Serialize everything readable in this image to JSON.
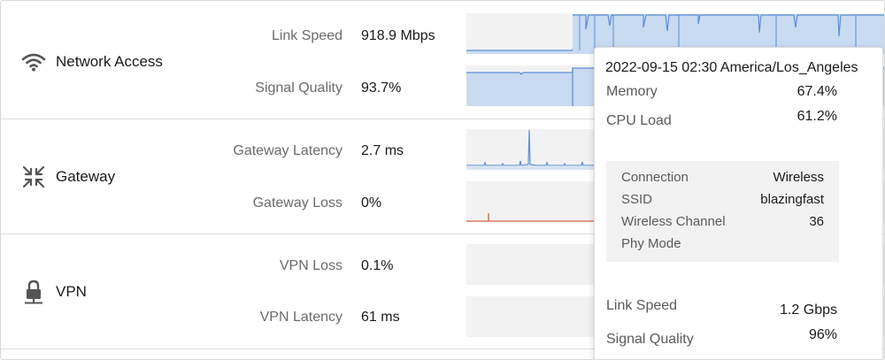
{
  "sections": {
    "network": {
      "title": "Network Access",
      "icon": "wifi-icon",
      "metrics": [
        {
          "label": "Link Speed",
          "value": "918.9 Mbps"
        },
        {
          "label": "Signal Quality",
          "value": "93.7%"
        }
      ]
    },
    "gateway": {
      "title": "Gateway",
      "icon": "gateway-arrows-icon",
      "metrics": [
        {
          "label": "Gateway Latency",
          "value": "2.7 ms"
        },
        {
          "label": "Gateway Loss",
          "value": "0%"
        }
      ]
    },
    "vpn": {
      "title": "VPN",
      "icon": "lock-network-icon",
      "metrics": [
        {
          "label": "VPN Loss",
          "value": "0.1%"
        },
        {
          "label": "VPN Latency",
          "value": "61 ms"
        }
      ]
    }
  },
  "tooltip": {
    "timestamp": "2022-09-15 02:30 America/Los_Angeles",
    "memory_label": "Memory",
    "memory_value": "67.4%",
    "cpu_label": "CPU Load",
    "cpu_value": "61.2%",
    "connection": {
      "rows": [
        {
          "label": "Connection",
          "value": "Wireless"
        },
        {
          "label": "SSID",
          "value": "blazingfast"
        },
        {
          "label": "Wireless Channel",
          "value": "36"
        },
        {
          "label": "Phy Mode",
          "value": ""
        }
      ]
    },
    "link_speed_label": "Link Speed",
    "link_speed_value": "1.2 Gbps",
    "signal_quality_label": "Signal Quality",
    "signal_quality_value": "96%"
  },
  "colors": {
    "series_blue": "#5b8fd6",
    "series_fill": "#c9dbf1",
    "loss_red": "#d9694a",
    "chart_bg": "#f2f2f2"
  }
}
